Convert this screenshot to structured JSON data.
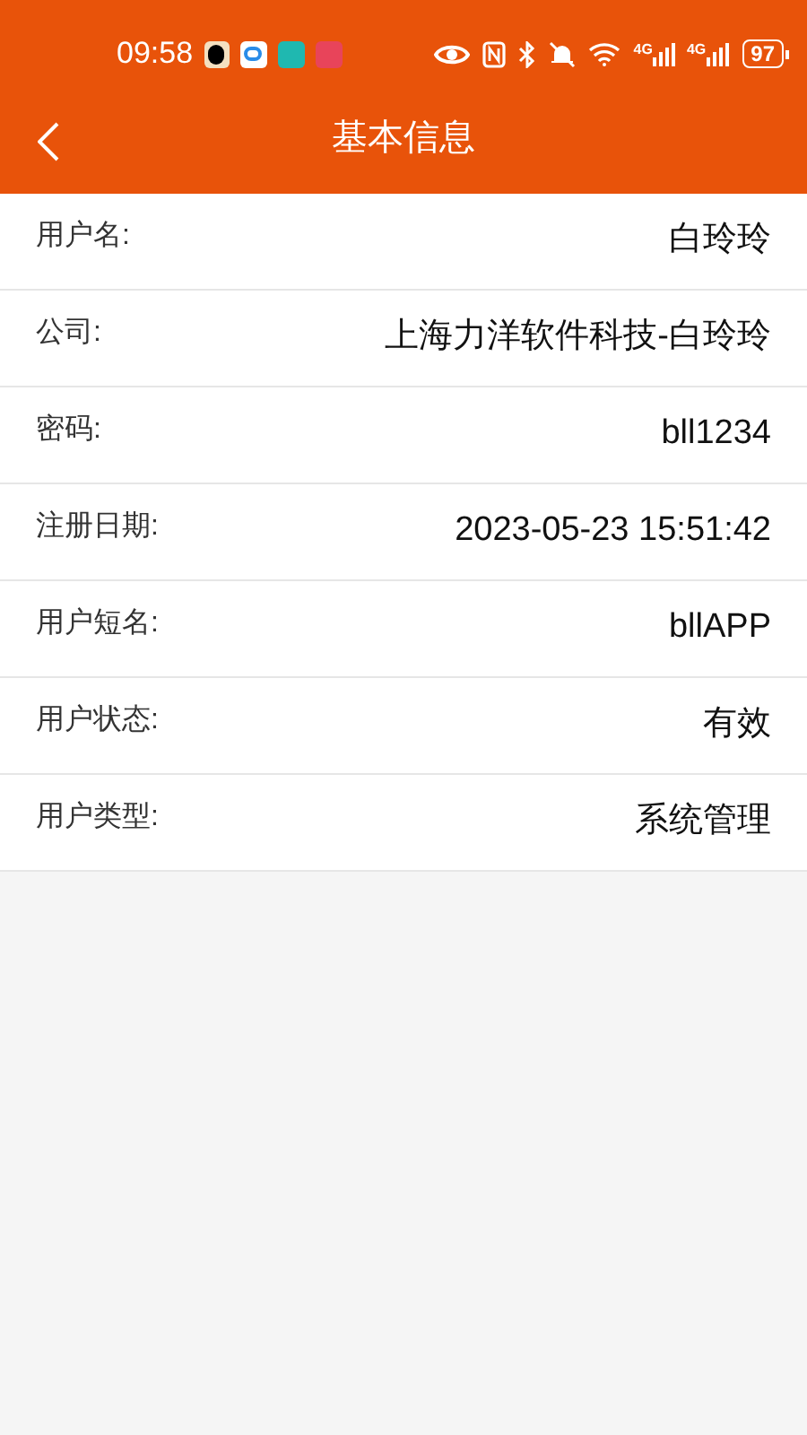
{
  "status_bar": {
    "time": "09:58",
    "network_labels": [
      "4G",
      "4G"
    ],
    "battery": "97"
  },
  "header": {
    "title": "基本信息"
  },
  "fields": [
    {
      "label": "用户名:",
      "value": "白玲玲"
    },
    {
      "label": "公司:",
      "value": "上海力洋软件科技-白玲玲"
    },
    {
      "label": "密码:",
      "value": "bll1234"
    },
    {
      "label": "注册日期:",
      "value": "2023-05-23 15:51:42"
    },
    {
      "label": "用户短名:",
      "value": "bllAPP"
    },
    {
      "label": "用户状态:",
      "value": "有效"
    },
    {
      "label": "用户类型:",
      "value": "系统管理"
    }
  ]
}
